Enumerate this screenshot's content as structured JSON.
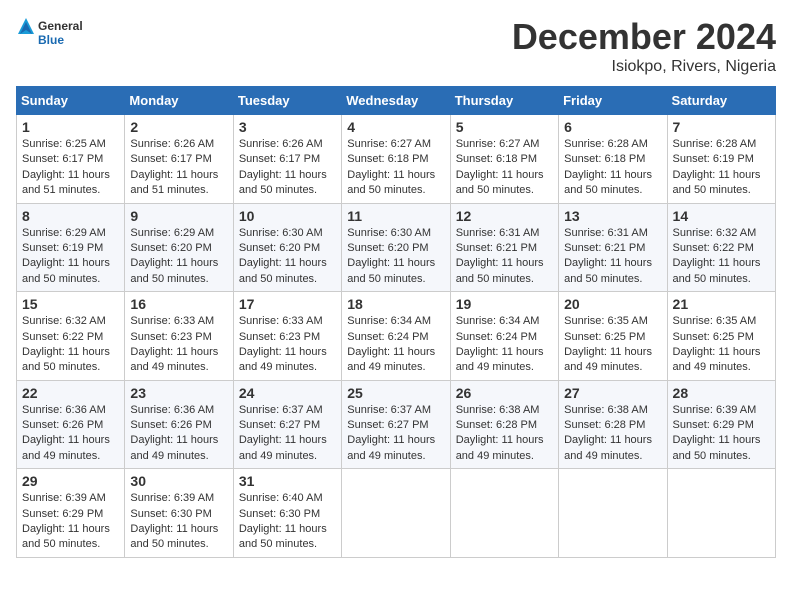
{
  "header": {
    "logo_general": "General",
    "logo_blue": "Blue",
    "title": "December 2024",
    "subtitle": "Isiokpo, Rivers, Nigeria"
  },
  "calendar": {
    "days_of_week": [
      "Sunday",
      "Monday",
      "Tuesday",
      "Wednesday",
      "Thursday",
      "Friday",
      "Saturday"
    ],
    "weeks": [
      [
        {
          "day": "1",
          "sunrise": "6:25 AM",
          "sunset": "6:17 PM",
          "daylight": "11 hours and 51 minutes."
        },
        {
          "day": "2",
          "sunrise": "6:26 AM",
          "sunset": "6:17 PM",
          "daylight": "11 hours and 51 minutes."
        },
        {
          "day": "3",
          "sunrise": "6:26 AM",
          "sunset": "6:17 PM",
          "daylight": "11 hours and 50 minutes."
        },
        {
          "day": "4",
          "sunrise": "6:27 AM",
          "sunset": "6:18 PM",
          "daylight": "11 hours and 50 minutes."
        },
        {
          "day": "5",
          "sunrise": "6:27 AM",
          "sunset": "6:18 PM",
          "daylight": "11 hours and 50 minutes."
        },
        {
          "day": "6",
          "sunrise": "6:28 AM",
          "sunset": "6:18 PM",
          "daylight": "11 hours and 50 minutes."
        },
        {
          "day": "7",
          "sunrise": "6:28 AM",
          "sunset": "6:19 PM",
          "daylight": "11 hours and 50 minutes."
        }
      ],
      [
        {
          "day": "8",
          "sunrise": "6:29 AM",
          "sunset": "6:19 PM",
          "daylight": "11 hours and 50 minutes."
        },
        {
          "day": "9",
          "sunrise": "6:29 AM",
          "sunset": "6:20 PM",
          "daylight": "11 hours and 50 minutes."
        },
        {
          "day": "10",
          "sunrise": "6:30 AM",
          "sunset": "6:20 PM",
          "daylight": "11 hours and 50 minutes."
        },
        {
          "day": "11",
          "sunrise": "6:30 AM",
          "sunset": "6:20 PM",
          "daylight": "11 hours and 50 minutes."
        },
        {
          "day": "12",
          "sunrise": "6:31 AM",
          "sunset": "6:21 PM",
          "daylight": "11 hours and 50 minutes."
        },
        {
          "day": "13",
          "sunrise": "6:31 AM",
          "sunset": "6:21 PM",
          "daylight": "11 hours and 50 minutes."
        },
        {
          "day": "14",
          "sunrise": "6:32 AM",
          "sunset": "6:22 PM",
          "daylight": "11 hours and 50 minutes."
        }
      ],
      [
        {
          "day": "15",
          "sunrise": "6:32 AM",
          "sunset": "6:22 PM",
          "daylight": "11 hours and 50 minutes."
        },
        {
          "day": "16",
          "sunrise": "6:33 AM",
          "sunset": "6:23 PM",
          "daylight": "11 hours and 49 minutes."
        },
        {
          "day": "17",
          "sunrise": "6:33 AM",
          "sunset": "6:23 PM",
          "daylight": "11 hours and 49 minutes."
        },
        {
          "day": "18",
          "sunrise": "6:34 AM",
          "sunset": "6:24 PM",
          "daylight": "11 hours and 49 minutes."
        },
        {
          "day": "19",
          "sunrise": "6:34 AM",
          "sunset": "6:24 PM",
          "daylight": "11 hours and 49 minutes."
        },
        {
          "day": "20",
          "sunrise": "6:35 AM",
          "sunset": "6:25 PM",
          "daylight": "11 hours and 49 minutes."
        },
        {
          "day": "21",
          "sunrise": "6:35 AM",
          "sunset": "6:25 PM",
          "daylight": "11 hours and 49 minutes."
        }
      ],
      [
        {
          "day": "22",
          "sunrise": "6:36 AM",
          "sunset": "6:26 PM",
          "daylight": "11 hours and 49 minutes."
        },
        {
          "day": "23",
          "sunrise": "6:36 AM",
          "sunset": "6:26 PM",
          "daylight": "11 hours and 49 minutes."
        },
        {
          "day": "24",
          "sunrise": "6:37 AM",
          "sunset": "6:27 PM",
          "daylight": "11 hours and 49 minutes."
        },
        {
          "day": "25",
          "sunrise": "6:37 AM",
          "sunset": "6:27 PM",
          "daylight": "11 hours and 49 minutes."
        },
        {
          "day": "26",
          "sunrise": "6:38 AM",
          "sunset": "6:28 PM",
          "daylight": "11 hours and 49 minutes."
        },
        {
          "day": "27",
          "sunrise": "6:38 AM",
          "sunset": "6:28 PM",
          "daylight": "11 hours and 49 minutes."
        },
        {
          "day": "28",
          "sunrise": "6:39 AM",
          "sunset": "6:29 PM",
          "daylight": "11 hours and 50 minutes."
        }
      ],
      [
        {
          "day": "29",
          "sunrise": "6:39 AM",
          "sunset": "6:29 PM",
          "daylight": "11 hours and 50 minutes."
        },
        {
          "day": "30",
          "sunrise": "6:39 AM",
          "sunset": "6:30 PM",
          "daylight": "11 hours and 50 minutes."
        },
        {
          "day": "31",
          "sunrise": "6:40 AM",
          "sunset": "6:30 PM",
          "daylight": "11 hours and 50 minutes."
        },
        null,
        null,
        null,
        null
      ]
    ]
  }
}
